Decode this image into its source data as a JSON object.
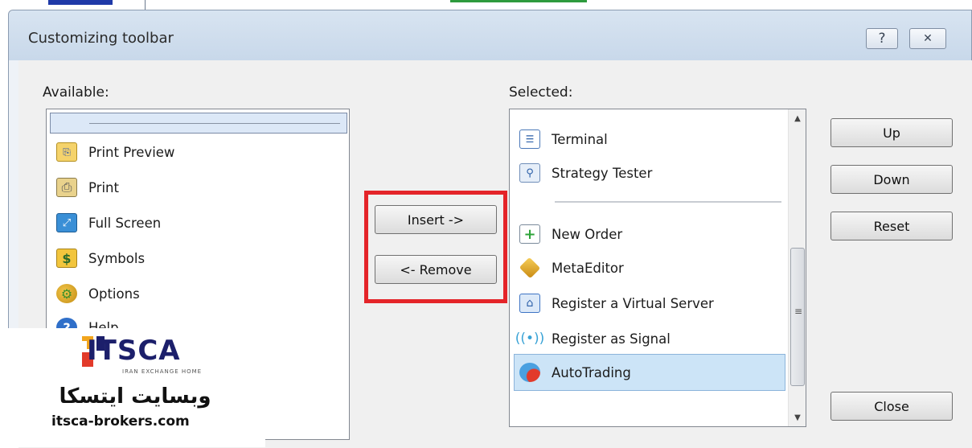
{
  "window": {
    "title": "Customizing toolbar",
    "help_glyph": "?",
    "close_glyph": "✕"
  },
  "available": {
    "label": "Available:",
    "items": [
      {
        "label": "Print Preview",
        "icon": "print-preview-icon"
      },
      {
        "label": "Print",
        "icon": "printer-icon"
      },
      {
        "label": "Full Screen",
        "icon": "full-screen-icon"
      },
      {
        "label": "Symbols",
        "icon": "symbols-icon"
      },
      {
        "label": "Options",
        "icon": "options-icon"
      },
      {
        "label": "Help",
        "icon": "help-icon"
      }
    ]
  },
  "actions": {
    "insert": "Insert ->",
    "remove": "<- Remove"
  },
  "selected": {
    "label": "Selected:",
    "items": [
      {
        "label": "Terminal",
        "icon": "terminal-icon"
      },
      {
        "label": "Strategy Tester",
        "icon": "strategy-tester-icon"
      },
      {
        "label": "New Order",
        "icon": "new-order-icon"
      },
      {
        "label": "MetaEditor",
        "icon": "metaeditor-icon"
      },
      {
        "label": "Register a Virtual Server",
        "icon": "virtual-server-icon"
      },
      {
        "label": "Register as Signal",
        "icon": "signal-icon"
      },
      {
        "label": "AutoTrading",
        "icon": "autotrading-icon",
        "selected": true
      }
    ]
  },
  "buttons": {
    "up": "Up",
    "down": "Down",
    "reset": "Reset",
    "close": "Close"
  },
  "watermark": {
    "brand": "ITSCA",
    "tagline": "IRAN EXCHANGE HOME",
    "persian": "وبسایت ایتسکا",
    "url": "itsca-brokers.com"
  },
  "colors": {
    "highlight_border": "#e42429",
    "selection_bg": "#cce4f7",
    "titlebar": "#c8d8ea"
  }
}
